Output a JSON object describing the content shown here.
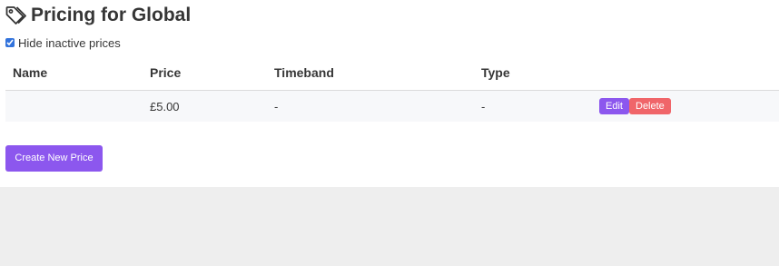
{
  "header": {
    "icon": "tag-icon",
    "title": "Pricing for Global"
  },
  "filter": {
    "hide_inactive_label": "Hide inactive prices",
    "hide_inactive_checked": true
  },
  "table": {
    "columns": [
      "Name",
      "Price",
      "Timeband",
      "Type"
    ],
    "rows": [
      {
        "name": "",
        "price": "£5.00",
        "timeband": "-",
        "type": "-",
        "edit_label": "Edit",
        "delete_label": "Delete"
      }
    ]
  },
  "actions": {
    "create_label": "Create New Price"
  },
  "colors": {
    "primary": "#8c57ee",
    "danger": "#f06569",
    "row_background": "#f7f8fa",
    "footer_background": "#eeeeee"
  }
}
